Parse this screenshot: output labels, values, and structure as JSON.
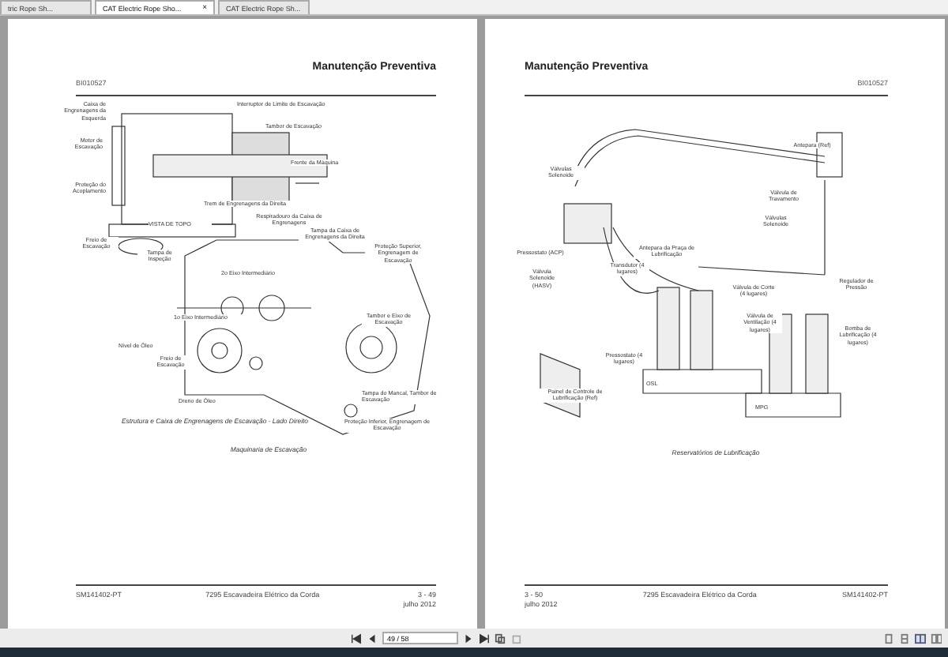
{
  "tabs": [
    {
      "label": "tric Rope Sh...",
      "selected": false
    },
    {
      "label": "CAT Electric Rope Sho...",
      "selected": true,
      "close": "×"
    },
    {
      "label": "CAT Electric Rope Sh...",
      "selected": false
    }
  ],
  "pages": [
    {
      "header": "Manutenção Preventiva",
      "doc_id": "BI010527",
      "figure": {
        "kind": "machinery",
        "labels": [
          "Caixa de Engrenagens da Esquerda",
          "Interruptor de Limite de Escavação",
          "Tambor de Escavação",
          "Motor de Escavação",
          "Frente da Máquina",
          "Proteção do Acoplamento",
          "Trem de Engrenagens da Direita",
          "VISTA DE TOPO",
          "Freio de Escavação",
          "Respiradouro da Caixa de Engrenagens",
          "Tampa da Caixa de Engrenagens da Direita",
          "Tampa de Inspeção",
          "Proteção Superior, Engrenagem de Escavação",
          "2o Eixo Intermediário",
          "1o Eixo Intermediário",
          "Tambor e Eixo de Escavação",
          "Nível de Óleo",
          "Freio de Escavação",
          "Dreno de Óleo",
          "Tampa do Mancal, Tambor de Escavação",
          "Proteção Inferior, Engrenagem de Escavação"
        ],
        "captions": [
          "Estrutura e Caixa de Engrenagens de Escavação - Lado Direito",
          "Maquinaria de Escavação"
        ]
      },
      "footer": {
        "code": "SM141402-PT",
        "title": "7295 Escavadeira Elétrico da Corda",
        "page": "3 - 49",
        "date": "julho 2012"
      }
    },
    {
      "header": "Manutenção Preventiva",
      "doc_id": "BI010527",
      "figure": {
        "kind": "lubrication",
        "labels": [
          "Antepara (Ref)",
          "Válvulas Solenoide",
          "Válvula de Travamento",
          "Válvulas Solenoide",
          "Pressostato (ACP)",
          "Antepara da Praça de Lubrificação",
          "Transdutor (4 lugares)",
          "Válvula Solenoide (HASV)",
          "Regulador de Pressão",
          "Válvula de Corte (4 lugares)",
          "Válvula de Ventilação (4 lugares)",
          "Bomba de Lubrificação (4 lugares)",
          "Pressostato (4 lugares)",
          "Painel de Controle de Lubrificação (Ref)",
          "OSL",
          "MPG"
        ],
        "captions": [
          "Reservatórios de Lubrificação"
        ]
      },
      "footer": {
        "code": "SM141402-PT",
        "title": "7295 Escavadeira Elétrico da Corda",
        "page": "3 - 50",
        "date": "julho 2012"
      }
    }
  ],
  "toolbar": {
    "page_field": "49 / 58"
  }
}
